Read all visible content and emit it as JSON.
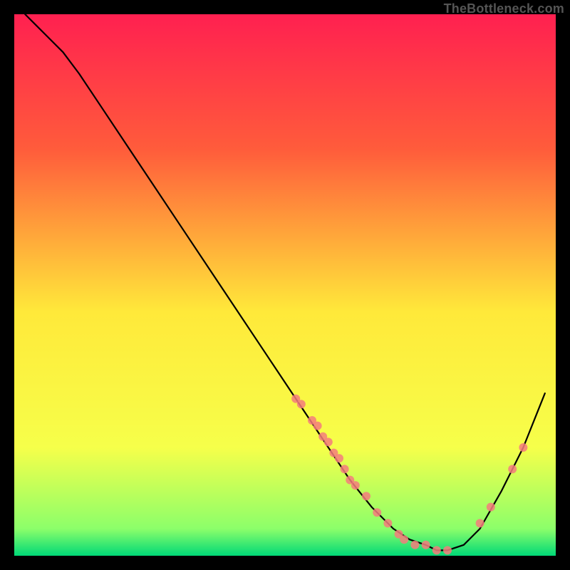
{
  "watermark": "TheBottleneck.com",
  "chart_data": {
    "type": "line",
    "title": "",
    "xlabel": "",
    "ylabel": "",
    "xlim": [
      0,
      100
    ],
    "ylim": [
      0,
      100
    ],
    "grid": false,
    "legend": false,
    "background_gradient": {
      "top": "#FF2050",
      "mid_upper": "#FF5C3B",
      "mid": "#FFE93A",
      "mid_lower": "#F6FF4A",
      "near_bottom": "#8CFF6A",
      "bottom": "#00D977"
    },
    "series": [
      {
        "name": "bottleneck-curve",
        "type": "line",
        "color": "#000000",
        "x": [
          2,
          4,
          6,
          9,
          12,
          16,
          22,
          30,
          38,
          46,
          52,
          58,
          62,
          66,
          70,
          73,
          76,
          78,
          80,
          83,
          86,
          90,
          94,
          98
        ],
        "y": [
          100,
          98,
          96,
          93,
          89,
          83,
          74,
          62,
          50,
          38,
          29,
          20,
          14,
          9,
          5,
          3,
          2,
          1,
          1,
          2,
          5,
          12,
          20,
          30
        ]
      },
      {
        "name": "data-points",
        "type": "scatter",
        "color": "#F47C7C",
        "x": [
          52,
          53,
          55,
          56,
          57,
          58,
          59,
          60,
          61,
          62,
          63,
          65,
          67,
          69,
          71,
          72,
          74,
          76,
          78,
          80,
          86,
          88,
          92,
          94
        ],
        "y": [
          29,
          28,
          25,
          24,
          22,
          21,
          19,
          18,
          16,
          14,
          13,
          11,
          8,
          6,
          4,
          3,
          2,
          2,
          1,
          1,
          6,
          9,
          16,
          20
        ]
      }
    ]
  }
}
